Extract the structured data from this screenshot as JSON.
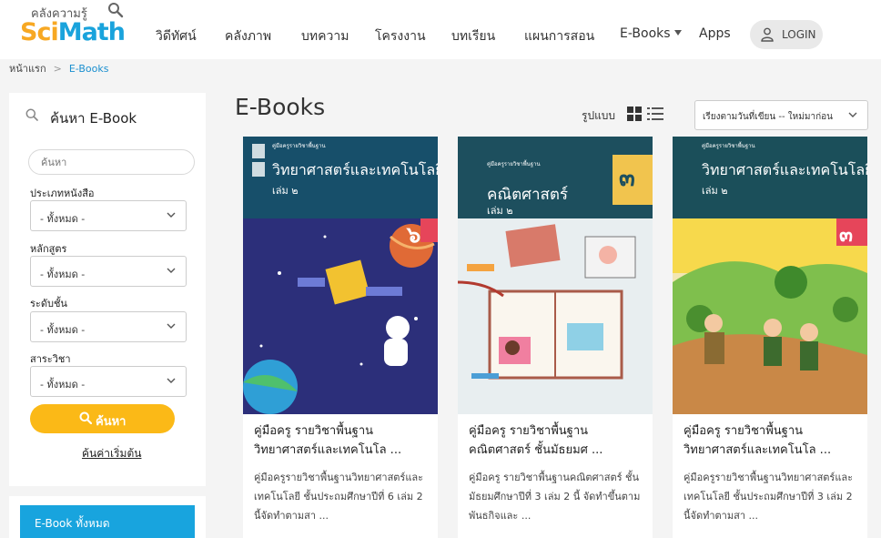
{
  "header": {
    "logo_small": "คลังความรู้",
    "logo_sci": "Sci",
    "logo_math": "Math",
    "nav": [
      "วิดีทัศน์",
      "คลังภาพ",
      "บทความ",
      "โครงงาน",
      "บทเรียน",
      "แผนการสอน",
      "E-Books",
      "Apps"
    ],
    "login": "LOGIN"
  },
  "breadcrumb": {
    "home": "หน้าแรก",
    "sep": ">",
    "current": "E-Books"
  },
  "sidebar": {
    "title": "ค้นหา E-Book",
    "keyword_placeholder": "ค้นหา",
    "filters": [
      {
        "label": "ประเภทหนังสือ",
        "value": "- ทั้งหมด -"
      },
      {
        "label": "หลักสูตร",
        "value": "- ทั้งหมด -"
      },
      {
        "label": "ระดับชั้น",
        "value": "- ทั้งหมด -"
      },
      {
        "label": "สาระวิชา",
        "value": "- ทั้งหมด -"
      }
    ],
    "search_button": "ค้นหา",
    "reset": "ค้นค่าเริ่มต้น",
    "all_ebooks": "E-Book ทั้งหมด"
  },
  "main": {
    "title": "E-Books",
    "layout_label": "รูปแบบ",
    "sort_value": "เรียงตามวันที่เขียน -- ใหม่มาก่อน"
  },
  "books": [
    {
      "title1": "คู่มือครู รายวิชาพื้นฐาน",
      "title2": "วิทยาศาสตร์และเทคโนโล ...",
      "desc1": "คู่มือครูรายวิชาพื้นฐานวิทยาศาสตร์และ",
      "desc2": "เทคโนโลยี ชั้นประถมศึกษาปีที่ 6 เล่ม 2",
      "desc3": "นี้จัดทำตามสา ...",
      "cover_heading": "วิทยาศาสตร์และเทคโนโลยี",
      "cover_volume": "เล่ม ๒",
      "cover_number": "๖",
      "cover_small": "คู่มือครูรายวิชาพื้นฐาน"
    },
    {
      "title1": "คู่มือครู รายวิชาพื้นฐาน",
      "title2": "คณิตศาสตร์ ชั้นมัธยมศ ...",
      "desc1": "คู่มือครู รายวิชาพื้นฐานคณิตศาสตร์ ชั้น",
      "desc2": "มัธยมศึกษาปีที่ 3 เล่ม 2 นี้ จัดทำขึ้นตาม",
      "desc3": "พันธกิจและ ...",
      "cover_heading": "คณิตศาสตร์",
      "cover_volume": "เล่ม ๒",
      "cover_number": "๓",
      "cover_small": "คู่มือครูรายวิชาพื้นฐาน"
    },
    {
      "title1": "คู่มือครู รายวิชาพื้นฐาน",
      "title2": "วิทยาศาสตร์และเทคโนโล ...",
      "desc1": "คู่มือครูรายวิชาพื้นฐานวิทยาศาสตร์และ",
      "desc2": "เทคโนโลยี ชั้นประถมศึกษาปีที่ 3 เล่ม 2",
      "desc3": "นี้จัดทำตามสา ...",
      "cover_heading": "วิทยาศาสตร์และเทคโนโลยี",
      "cover_volume": "เล่ม ๒",
      "cover_number": "๓",
      "cover_small": "คู่มือครูรายวิชาพื้นฐาน"
    }
  ]
}
